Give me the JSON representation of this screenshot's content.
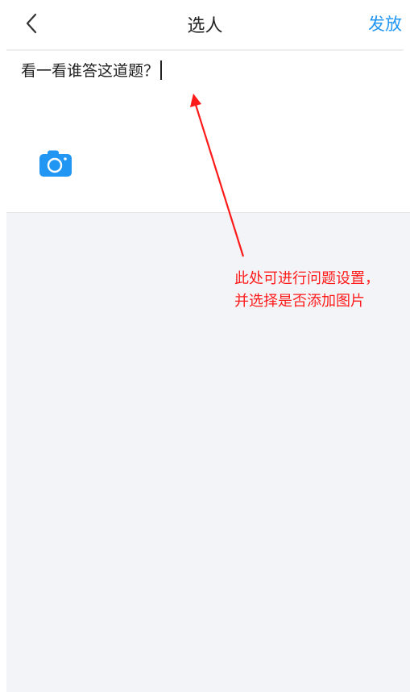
{
  "header": {
    "back_icon": "chevron-left-icon",
    "title": "选人",
    "publish_label": "发放"
  },
  "editor": {
    "question_value": "看一看谁答这道题？",
    "camera_icon": "camera-icon"
  },
  "annotation": {
    "line1": "此处可进行问题设置，",
    "line2": "并选择是否添加图片"
  },
  "colors": {
    "accent": "#2196f3",
    "annotation": "#ff1a1a",
    "background_gray": "#f3f4f7"
  }
}
